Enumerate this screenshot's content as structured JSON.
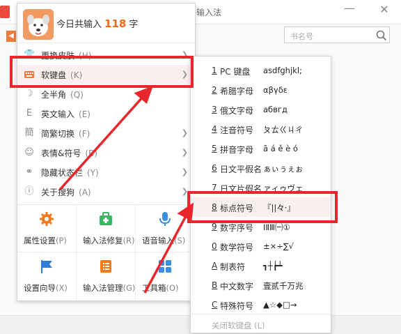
{
  "window": {
    "title_fragment": "输入法",
    "search_placeholder": "书名号"
  },
  "menu": {
    "stat_prefix": "今日共输入",
    "stat_count": "118",
    "stat_suffix": "字",
    "items": [
      {
        "label": "更换皮肤",
        "key": "(H)",
        "icon": "shirt-icon",
        "has_sub": true
      },
      {
        "label": "软键盘",
        "key": "(K)",
        "icon": "keyboard-icon",
        "has_sub": true
      },
      {
        "label": "全半角",
        "key": "(Q)",
        "icon": "moon-icon",
        "has_sub": false
      },
      {
        "label": "英文输入",
        "key": "(E)",
        "icon": "letter-e-icon",
        "has_sub": false
      },
      {
        "label": "简繁切换",
        "key": "(F)",
        "icon": "traditional-char-icon",
        "has_sub": true
      },
      {
        "label": "表情&符号",
        "key": "(B)",
        "icon": "smiley-icon",
        "has_sub": true
      },
      {
        "label": "隐藏状态栏",
        "key": "(Y)",
        "icon": "hide-status-icon",
        "has_sub": true
      },
      {
        "label": "关于搜狗",
        "key": "(A)",
        "icon": "question-icon",
        "has_sub": true
      }
    ],
    "grid": [
      {
        "label": "属性设置",
        "key": "(P)",
        "icon": "settings-gear-icon"
      },
      {
        "label": "输入法修复",
        "key": "(R)",
        "icon": "repair-kit-icon"
      },
      {
        "label": "语音输入",
        "key": "(S)",
        "icon": "microphone-icon"
      },
      {
        "label": "设置向导",
        "key": "(X)",
        "icon": "flag-icon"
      },
      {
        "label": "输入法管理",
        "key": "(G)",
        "icon": "list-manage-icon"
      },
      {
        "label": "工具箱",
        "key": "(O)",
        "icon": "toolbox-grid-icon"
      }
    ]
  },
  "submenu": {
    "items": [
      {
        "num": "1",
        "label": "PC 键盘",
        "sample": "asdfghjkl;"
      },
      {
        "num": "2",
        "label": "希腊字母",
        "sample": "αβγδε"
      },
      {
        "num": "3",
        "label": "俄文字母",
        "sample": "абвгд"
      },
      {
        "num": "4",
        "label": "注音符号",
        "sample": "ㄆㄊㄍㄐㄔ"
      },
      {
        "num": "5",
        "label": "拼音字母",
        "sample": "ā á ě è ó"
      },
      {
        "num": "6",
        "label": "日文平假名",
        "sample": "ぁぃぅぇぉ"
      },
      {
        "num": "7",
        "label": "日文片假名",
        "sample": "ァィゥヴェ"
      },
      {
        "num": "8",
        "label": "标点符号",
        "sample": "『||々·』"
      },
      {
        "num": "9",
        "label": "数字序号",
        "sample": "ⅠⅡⅢ㈠①"
      },
      {
        "num": "0",
        "label": "数学符号",
        "sample": "±×÷∑√"
      },
      {
        "num": "A",
        "label": "制表符",
        "sample": "┓┼┢┷"
      },
      {
        "num": "B",
        "label": "中文数字",
        "sample": "壹贰千万兆"
      },
      {
        "num": "C",
        "label": "特殊符号",
        "sample": "▲☆◆□→"
      }
    ],
    "close_label": "关闭软键盘 (L)"
  },
  "colors": {
    "accent": "#f06a1c",
    "highlight": "#e9262b",
    "active_bg": "#fbeeee"
  }
}
